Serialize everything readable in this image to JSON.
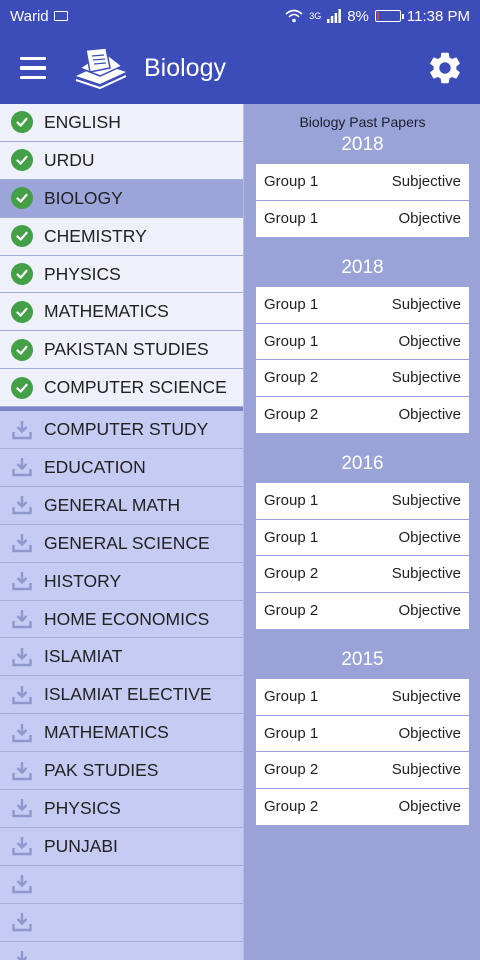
{
  "status": {
    "carrier": "Warid",
    "network": "3G",
    "battery": "8%",
    "battery_level": 0.08,
    "time": "11:38 PM"
  },
  "appbar": {
    "title": "Biology"
  },
  "sidebar": {
    "downloaded": [
      {
        "label": "ENGLISH",
        "selected": false
      },
      {
        "label": "URDU",
        "selected": false
      },
      {
        "label": "BIOLOGY",
        "selected": true
      },
      {
        "label": "CHEMISTRY",
        "selected": false
      },
      {
        "label": "PHYSICS",
        "selected": false
      },
      {
        "label": "MATHEMATICS",
        "selected": false
      },
      {
        "label": "PAKISTAN STUDIES",
        "selected": false
      },
      {
        "label": "COMPUTER SCIENCE",
        "selected": false
      }
    ],
    "available": [
      {
        "label": "COMPUTER STUDY"
      },
      {
        "label": "EDUCATION"
      },
      {
        "label": "GENERAL MATH"
      },
      {
        "label": "GENERAL SCIENCE"
      },
      {
        "label": "HISTORY"
      },
      {
        "label": "HOME ECONOMICS"
      },
      {
        "label": "ISLAMIAT"
      },
      {
        "label": "ISLAMIAT ELECTIVE"
      },
      {
        "label": "MATHEMATICS"
      },
      {
        "label": "PAK STUDIES"
      },
      {
        "label": "PHYSICS"
      },
      {
        "label": "PUNJABI"
      },
      {
        "label": ""
      },
      {
        "label": ""
      },
      {
        "label": ""
      }
    ]
  },
  "main": {
    "heading": "Biology Past Papers",
    "sections": [
      {
        "year": "2018",
        "papers": [
          {
            "group": "Group 1",
            "type": "Subjective"
          },
          {
            "group": "Group 1",
            "type": "Objective"
          }
        ]
      },
      {
        "year": "2018",
        "papers": [
          {
            "group": "Group 1",
            "type": "Subjective"
          },
          {
            "group": "Group 1",
            "type": "Objective"
          },
          {
            "group": "Group 2",
            "type": "Subjective"
          },
          {
            "group": "Group 2",
            "type": "Objective"
          }
        ]
      },
      {
        "year": "2016",
        "papers": [
          {
            "group": "Group 1",
            "type": "Subjective"
          },
          {
            "group": "Group 1",
            "type": "Objective"
          },
          {
            "group": "Group 2",
            "type": "Subjective"
          },
          {
            "group": "Group 2",
            "type": "Objective"
          }
        ]
      },
      {
        "year": "2015",
        "papers": [
          {
            "group": "Group 1",
            "type": "Subjective"
          },
          {
            "group": "Group 1",
            "type": "Objective"
          },
          {
            "group": "Group 2",
            "type": "Subjective"
          },
          {
            "group": "Group 2",
            "type": "Objective"
          }
        ]
      }
    ]
  },
  "colors": {
    "primary": "#3c4cb8",
    "sidebar_bg": "#c5cbf3",
    "selected_bg": "#9ca5da",
    "panel_bg": "#9aa3d8",
    "check_green": "#43a047"
  }
}
